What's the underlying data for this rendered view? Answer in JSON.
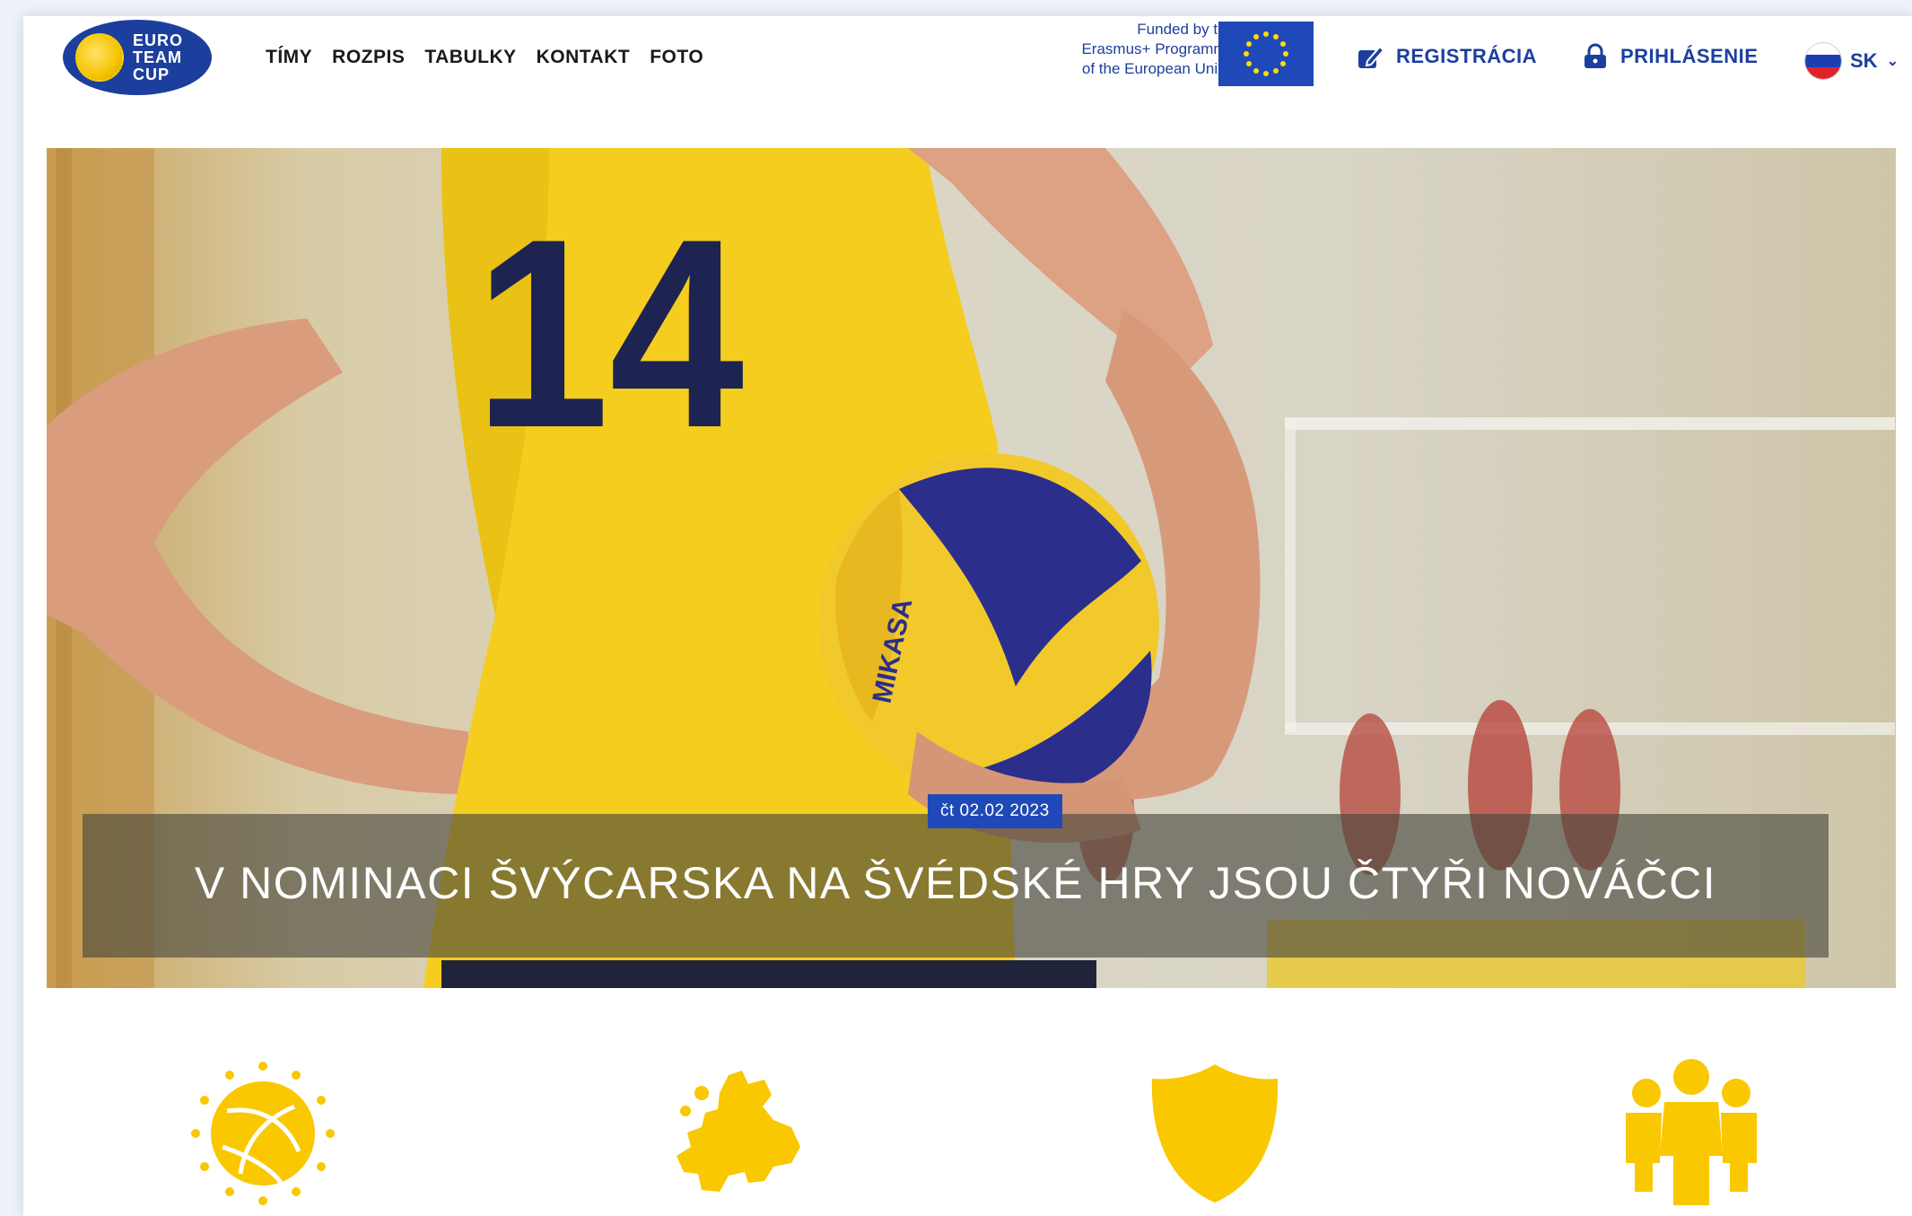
{
  "header": {
    "logo_text": [
      "EURO",
      "TEAM",
      "CUP"
    ],
    "nav": [
      "TÍMY",
      "ROZPIS",
      "TABULKY",
      "KONTAKT",
      "FOTO"
    ],
    "funded_lines": [
      "Funded by the",
      "Erasmus+ Programme",
      "of the European Union"
    ],
    "register_label": "REGISTRÁCIA",
    "login_label": "PRIHLÁSENIE",
    "language": "SK"
  },
  "hero": {
    "jersey_number": "14",
    "ball_brand": "MIKASA",
    "date": "čt 02.02 2023",
    "headline": "V NOMINACI ŠVÝCARSKA NA ŠVÉDSKÉ HRY JSOU ČTYŘI NOVÁČCI"
  },
  "features": [
    {
      "icon": "volleyball-stars-icon"
    },
    {
      "icon": "europe-map-icon"
    },
    {
      "icon": "shield-icon"
    },
    {
      "icon": "team-icon"
    }
  ],
  "colors": {
    "brand_blue": "#1c3f9e",
    "eu_blue": "#1f49b8",
    "accent_yellow": "#f9c800"
  }
}
